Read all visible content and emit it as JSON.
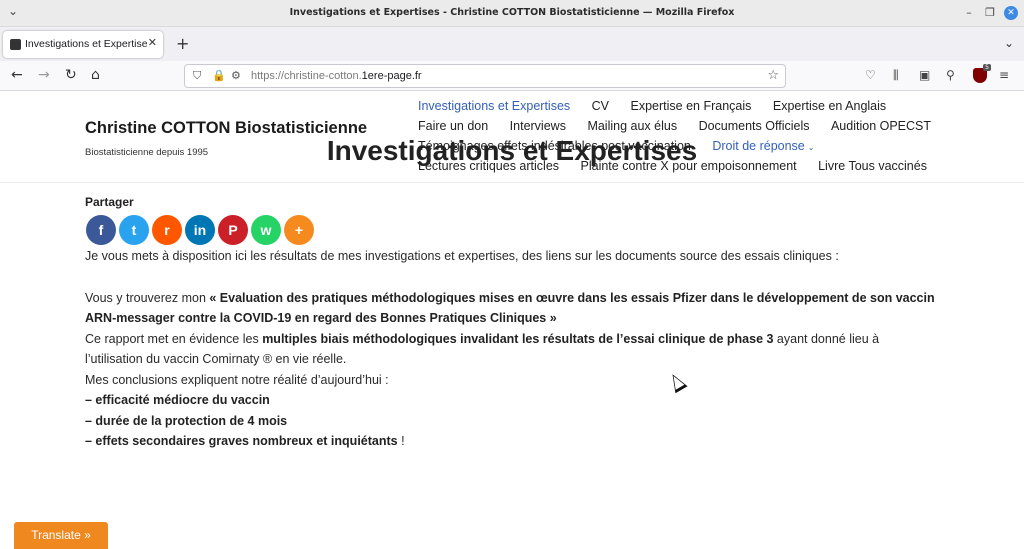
{
  "window": {
    "title": "Investigations et Expertises - Christine COTTON Biostatisticienne — Mozilla Firefox",
    "menu_glyph": "⌄",
    "minimize_glyph": "–",
    "restore_glyph": "❐",
    "close_glyph": "✕"
  },
  "tabs": [
    {
      "label": "Investigations et Expertises - Christine COTTON Biostatisticienne",
      "close": "✕"
    }
  ],
  "tabbar": {
    "new_tab": "+",
    "list_tabs": "⌄"
  },
  "navbar": {
    "back": "←",
    "forward": "→",
    "reload": "↻",
    "home": "⌂",
    "url_prefix": "https://christine-cotton.",
    "url_domain": "1ere-page.fr",
    "shield": "⛉",
    "lock": "🔒",
    "perm": "⚙",
    "bookmark": "☆",
    "pocket": "♡",
    "library": "⫼",
    "sidebar": "▣",
    "extensions": "⚲",
    "ublock_count": "5",
    "menu": "≡"
  },
  "site": {
    "title": "Christine COTTON Biostatisticienne",
    "tagline": "Biostatisticienne depuis 1995"
  },
  "menu": {
    "rows": [
      [
        "Investigations et Expertises",
        "CV",
        "Expertise en Français",
        "Expertise en Anglais"
      ],
      [
        "Faire un don",
        "Interviews",
        "Mailing aux élus",
        "Documents Officiels",
        "Audition OPECST"
      ],
      [
        "Témoignages effets indésirables post vaccination",
        "Droit de réponse"
      ],
      [
        "Lectures critiques articles",
        "Plainte contre X pour empoisonnement",
        "Livre Tous vaccinés"
      ]
    ],
    "caret": "⌄"
  },
  "main": {
    "title": "Investigations et Expertises",
    "share_label": "Partager",
    "share_buttons": [
      {
        "name": "facebook",
        "glyph": "f",
        "color": "#3b5998"
      },
      {
        "name": "twitter",
        "glyph": "t",
        "color": "#2aa3ef"
      },
      {
        "name": "reddit",
        "glyph": "r",
        "color": "#ff5700"
      },
      {
        "name": "linkedin",
        "glyph": "in",
        "color": "#0077b5"
      },
      {
        "name": "pinterest",
        "glyph": "P",
        "color": "#cb2027"
      },
      {
        "name": "whatsapp",
        "glyph": "w",
        "color": "#25d366"
      },
      {
        "name": "more",
        "glyph": "+",
        "color": "#f58a1f"
      }
    ],
    "intro": "Je vous mets à disposition ici les résultats de mes investigations et expertises, des liens sur les documents source des essais cliniques :",
    "p1_pre": "Vous y trouverez mon ",
    "p1_bold": "« Evaluation des pratiques méthodologiques mises en œuvre dans les essais Pfizer dans le développement de son vaccin ARN-messager contre la COVID-19 en regard des Bonnes Pratiques Cliniques »",
    "p2_pre": "Ce rapport met en évidence les ",
    "p2_bold": "multiples biais méthodologiques invalidant les résultats de l’essai clinique de phase 3",
    "p2_post": " ayant donné lieu à l’utilisation du vaccin Comirnaty ® en vie réelle.",
    "conclusions": "Mes conclusions expliquent notre réalité d’aujourd’hui :",
    "bullet1": "– efficacité médiocre du vaccin",
    "bullet2": "– durée de la protection de 4 mois",
    "bullet3_bold": "– effets secondaires graves nombreux et inquiétants",
    "bullet3_post": " !"
  },
  "translate": {
    "label": "Translate »"
  }
}
